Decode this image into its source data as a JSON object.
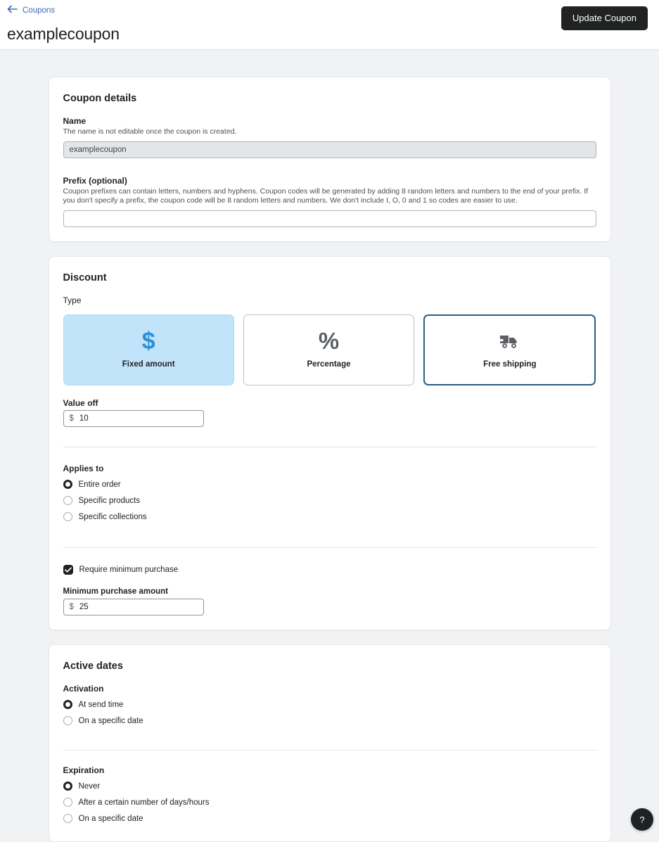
{
  "header": {
    "back_label": "Coupons",
    "back_icon": "arrow-left-icon",
    "title": "examplecoupon",
    "primary_action": "Update Coupon"
  },
  "coupon_details": {
    "card_title": "Coupon details",
    "name_label": "Name",
    "name_help": "The name is not editable once the coupon is created.",
    "name_value": "examplecoupon",
    "name_placeholder": "",
    "prefix_label": "Prefix (optional)",
    "prefix_help": "Coupon prefixes can contain letters, numbers and hyphens. Coupon codes will be generated by adding 8 random letters and numbers to the end of your prefix. If you don't specify a prefix, the coupon code will be 8 random letters and numbers. We don't include I, O, 0 and 1 so codes are easier to use.",
    "prefix_value": "",
    "prefix_placeholder": ""
  },
  "discount": {
    "card_title": "Discount",
    "type_label": "Type",
    "types": [
      {
        "label": "Fixed amount",
        "icon": "dollar-sign-icon",
        "selected": true,
        "focused": false
      },
      {
        "label": "Percentage",
        "icon": "percent-icon",
        "selected": false,
        "focused": false
      },
      {
        "label": "Free shipping",
        "icon": "truck-icon",
        "selected": false,
        "focused": true
      }
    ],
    "value_off_label": "Value off",
    "value_off_prefix": "$",
    "value_off_value": "10",
    "applies_to_label": "Applies to",
    "applies_to_options": [
      {
        "label": "Entire order",
        "checked": true
      },
      {
        "label": "Specific products",
        "checked": false
      },
      {
        "label": "Specific collections",
        "checked": false
      }
    ],
    "require_minimum_label": "Require minimum purchase",
    "require_minimum_checked": true,
    "minimum_amount_label": "Minimum purchase amount",
    "minimum_amount_prefix": "$",
    "minimum_amount_value": "25"
  },
  "active_dates": {
    "card_title": "Active dates",
    "activation_label": "Activation",
    "activation_options": [
      {
        "label": "At send time",
        "checked": true
      },
      {
        "label": "On a specific date",
        "checked": false
      }
    ],
    "expiration_label": "Expiration",
    "expiration_options": [
      {
        "label": "Never",
        "checked": true
      },
      {
        "label": "After a certain number of days/hours",
        "checked": false
      },
      {
        "label": "On a specific date",
        "checked": false
      }
    ]
  },
  "help": {
    "label": "?",
    "icon": "question-mark-icon"
  },
  "colors": {
    "accent_blue": "#2d8fd5",
    "selected_card_bg": "#c2e4fb",
    "focus_border": "#2c5d82",
    "link": "#3f69b0",
    "page_bg": "#f1f2f4",
    "primary_button_bg": "#202223"
  }
}
